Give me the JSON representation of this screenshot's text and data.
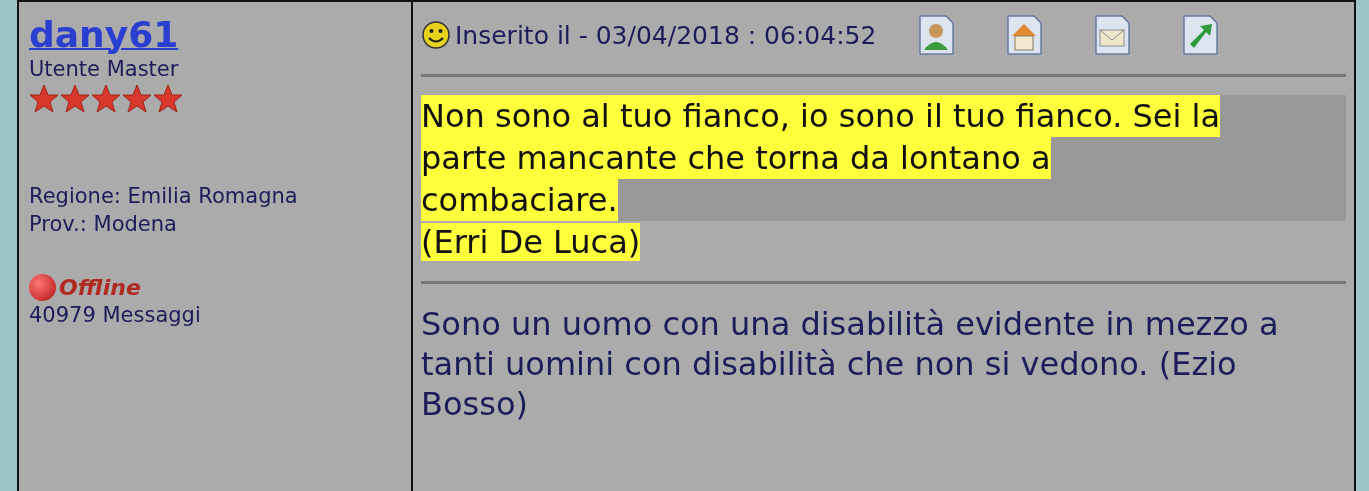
{
  "author": {
    "name": "dany61",
    "rank": "Utente Master",
    "stars": 5,
    "region": "Regione: Emilia Romagna",
    "province": "Prov.: Modena",
    "online": false,
    "status": "Offline",
    "posts": "40979 Messaggi"
  },
  "post": {
    "posted": "Inserito il - 03/04/2018 : 06:04:52",
    "quote_lines": [
      "Non sono al tuo fianco, io sono il tuo fianco. Sei la",
      "parte mancante che torna da lontano a",
      "combaciare."
    ],
    "quote_source": "(Erri De Luca)",
    "signature": "Sono un uomo con una disabilità evidente in mezzo a tanti uomini con disabilità che non si vedono. (Ezio Bosso)"
  }
}
